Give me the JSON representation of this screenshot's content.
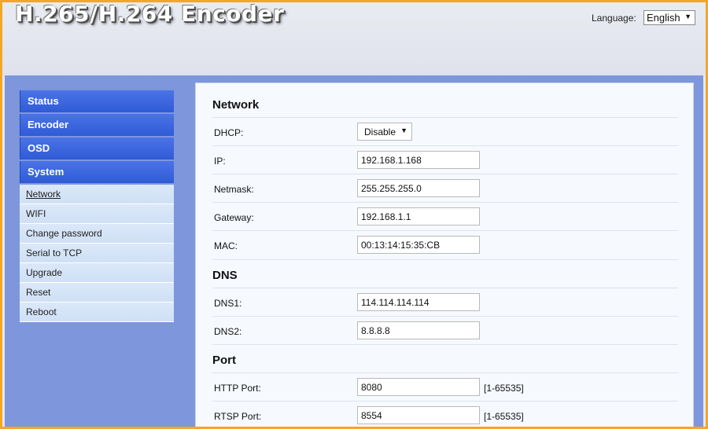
{
  "header": {
    "title": "H.265/H.264 Encoder",
    "language_label": "Language:",
    "language_value": "English"
  },
  "sidebar": {
    "sections": [
      {
        "label": "Status"
      },
      {
        "label": "Encoder"
      },
      {
        "label": "OSD"
      },
      {
        "label": "System"
      }
    ],
    "system_items": [
      {
        "label": "Network",
        "active": true
      },
      {
        "label": "WIFI"
      },
      {
        "label": "Change password"
      },
      {
        "label": "Serial to TCP"
      },
      {
        "label": "Upgrade"
      },
      {
        "label": "Reset"
      },
      {
        "label": "Reboot"
      }
    ]
  },
  "network": {
    "title": "Network",
    "dhcp_label": "DHCP:",
    "dhcp_value": "Disable",
    "ip_label": "IP:",
    "ip_value": "192.168.1.168",
    "netmask_label": "Netmask:",
    "netmask_value": "255.255.255.0",
    "gateway_label": "Gateway:",
    "gateway_value": "192.168.1.1",
    "mac_label": "MAC:",
    "mac_value": "00:13:14:15:35:CB"
  },
  "dns": {
    "title": "DNS",
    "dns1_label": "DNS1:",
    "dns1_value": "114.114.114.114",
    "dns2_label": "DNS2:",
    "dns2_value": "8.8.8.8"
  },
  "port": {
    "title": "Port",
    "http_label": "HTTP Port:",
    "http_value": "8080",
    "http_range": "[1-65535]",
    "rtsp_label": "RTSP Port:",
    "rtsp_value": "8554",
    "rtsp_range": "[1-65535]"
  },
  "colors": {
    "frame_border": "#f5a623",
    "menu_head": "#3a64dc",
    "main_bg": "#7d96dc"
  }
}
